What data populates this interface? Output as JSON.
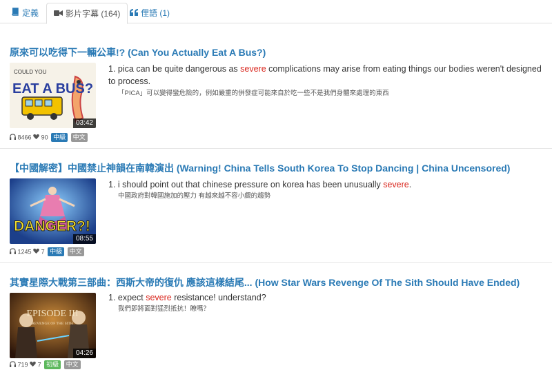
{
  "tabs": [
    {
      "label": "定義",
      "icon": "book-icon",
      "active": false
    },
    {
      "label": "影片字幕 (164)",
      "icon": "video-camera-icon",
      "active": true
    },
    {
      "label": "俚語 (1)",
      "icon": "quote-icon",
      "active": false
    }
  ],
  "colors": {
    "link": "#2a7ab5",
    "highlight": "#d9251c",
    "level_mid": "#2a7ab5",
    "level_beg": "#5cb85c",
    "lang": "#999999"
  },
  "entries": [
    {
      "title": "原來可以吃得下一輛公車!? (Can You Actually Eat A Bus?)",
      "duration": "03:42",
      "thumb_text": "EAT A BUS?",
      "thumb_small": "COULD YOU",
      "listens": "8466",
      "likes": "90",
      "level": "中級",
      "lang": "中文",
      "number": "1.",
      "before": "pica can be quite dangerous as ",
      "keyword": "severe",
      "after": " complications may arise from eating things our bodies weren't designed to process.",
      "translation": "「PICA」可以變得蠻危險的，例如嚴重的併發症可能來自於吃一些不是我們身體來處理的東西"
    },
    {
      "title": "【中國解密】中國禁止神韻在南韓演出 (Warning! China Tells South Korea To Stop Dancing | China Uncensored)",
      "duration": "08:55",
      "thumb_text": "DANGER?!",
      "listens": "1245",
      "likes": "7",
      "level": "中級",
      "lang": "中文",
      "number": "1.",
      "before": "i should point out that chinese pressure on korea has been unusually ",
      "keyword": "severe",
      "after": ".",
      "translation": "中國政府對韓國施加的壓力 有越來越不容小覷的趨勢"
    },
    {
      "title": "其實星際大戰第三部曲：西斯大帝的復仇 應該這樣結尾... (How Star Wars Revenge Of The Sith Should Have Ended)",
      "duration": "04:26",
      "thumb_text": "EPISODE III",
      "thumb_small": "REVENGE OF THE SITH",
      "listens": "719",
      "likes": "7",
      "level": "初級",
      "lang": "中文",
      "number": "1.",
      "before": "expect ",
      "keyword": "severe",
      "after": " resistance! understand?",
      "translation": "我們即將面對猛烈抵抗！瞭嗎？"
    }
  ]
}
